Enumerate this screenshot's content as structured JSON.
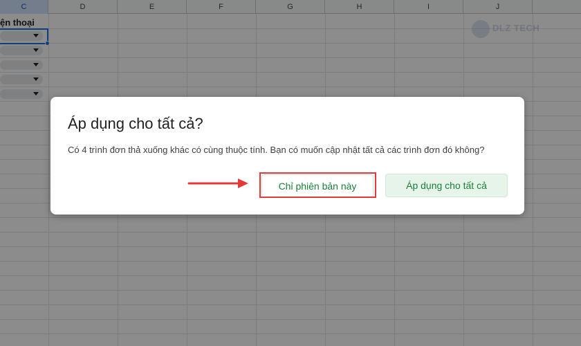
{
  "spreadsheet": {
    "columns": [
      {
        "label": "C",
        "selected": true
      },
      {
        "label": "D",
        "selected": false
      },
      {
        "label": "E",
        "selected": false
      },
      {
        "label": "F",
        "selected": false
      },
      {
        "label": "G",
        "selected": false
      },
      {
        "label": "H",
        "selected": false
      },
      {
        "label": "I",
        "selected": false
      },
      {
        "label": "J",
        "selected": false
      }
    ],
    "header_cell_text": "ện thoại",
    "dropdown_count": 5
  },
  "watermark": {
    "text": "DLZ TECH"
  },
  "dialog": {
    "title": "Áp dụng cho tất cả?",
    "message": "Có 4 trình đơn thả xuống khác có cùng thuộc tính. Bạn có muốn cập nhật tất cả các trình đơn đó không?",
    "secondary_button": "Chỉ phiên bản này",
    "primary_button": "Áp dụng cho tất cả"
  },
  "colors": {
    "accent_green": "#188038",
    "primary_bg": "#e6f4ea",
    "annotation_red": "#e53935",
    "selection_blue": "#1a73e8"
  },
  "icons": [
    "dropdown-arrow-icon",
    "annotation-arrow-icon"
  ]
}
